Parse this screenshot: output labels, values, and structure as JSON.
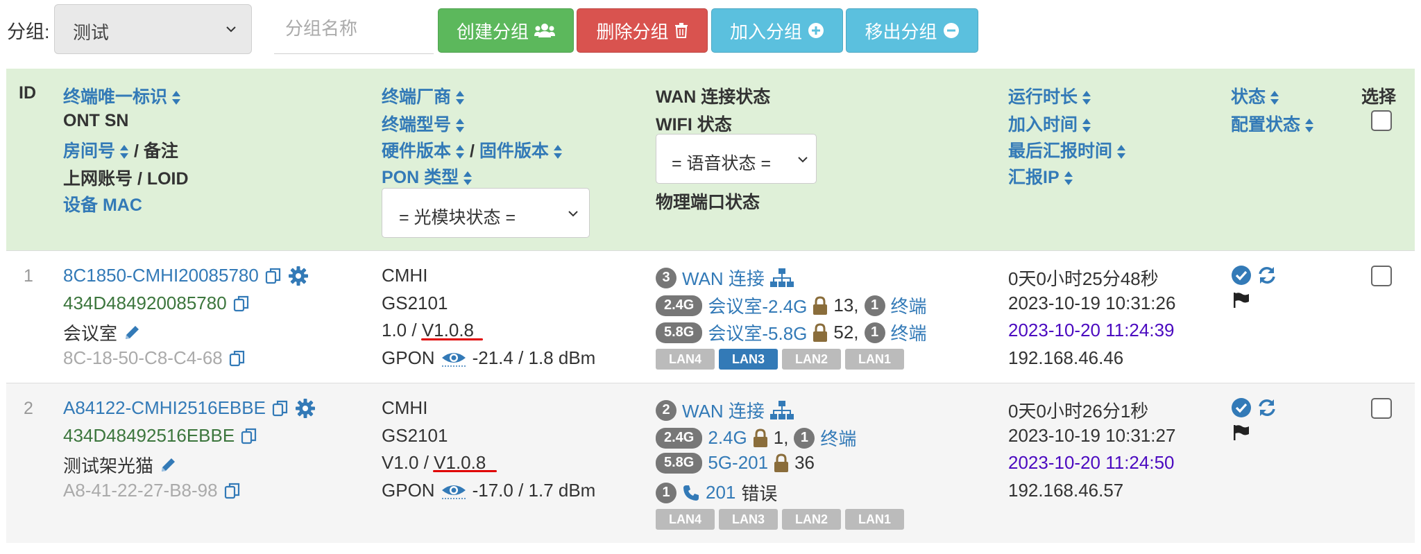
{
  "toolbar": {
    "group_label": "分组:",
    "group_select_value": "测试",
    "group_name_placeholder": "分组名称",
    "create_label": "创建分组",
    "delete_label": "删除分组",
    "join_label": "加入分组",
    "leave_label": "移出分组"
  },
  "header": {
    "id": "ID",
    "terminal_id": "终端唯一标识",
    "ont_sn": "ONT SN",
    "room": "房间号",
    "slash_remark": "/ 备注",
    "account": "上网账号 / LOID",
    "mac": "设备 MAC",
    "vendor": "终端厂商",
    "model": "终端型号",
    "hw_version": "硬件版本",
    "slash": "/",
    "fw_version": "固件版本",
    "pon_type": "PON 类型",
    "optical_select": "= 光模块状态 =",
    "wan_status": "WAN 连接状态",
    "wifi_status": "WIFI 状态",
    "voice_select": "= 语音状态 =",
    "port_status": "物理端口状态",
    "uptime": "运行时长",
    "join_time": "加入时间",
    "last_report": "最后汇报时间",
    "report_ip": "汇报IP",
    "state": "状态",
    "config_state": "配置状态",
    "select": "选择"
  },
  "rows": [
    {
      "id": "1",
      "terminal_id": "8C1850-CMHI20085780",
      "ont_sn": "434D484920085780",
      "remark": "会议室",
      "mac": "8C-18-50-C8-C4-68",
      "vendor": "CMHI",
      "model": "GS2101",
      "hw_version": "1.0 / ",
      "fw_version": "V1.0.8",
      "pon": "GPON",
      "optical": "-21.4 / 1.8 dBm",
      "wan_count": "3",
      "wan_label": "WAN 连接",
      "wifi24_badge": "2.4G",
      "wifi24_name": "会议室-2.4G",
      "wifi24_channel": "13,",
      "wifi24_clients": "1",
      "wifi24_clients_label": "终端",
      "wifi58_badge": "5.8G",
      "wifi58_name": "会议室-5.8G",
      "wifi58_channel": "52,",
      "wifi58_clients": "1",
      "wifi58_clients_label": "终端",
      "lan": [
        "LAN4",
        "LAN3",
        "LAN2",
        "LAN1"
      ],
      "lan_active": "LAN3",
      "uptime": "0天0小时25分48秒",
      "join_time": "2023-10-19 10:31:26",
      "last_report": "2023-10-20 11:24:39",
      "report_ip": "192.168.46.46"
    },
    {
      "id": "2",
      "terminal_id": "A84122-CMHI2516EBBE",
      "ont_sn": "434D48492516EBBE",
      "remark": "测试架光猫",
      "mac": "A8-41-22-27-B8-98",
      "vendor": "CMHI",
      "model": "GS2101",
      "hw_version": "V1.0 / ",
      "fw_version": "V1.0.8",
      "pon": "GPON",
      "optical": "-17.0 / 1.7 dBm",
      "wan_count": "2",
      "wan_label": "WAN 连接",
      "wifi24_badge": "2.4G",
      "wifi24_name": "2.4G",
      "wifi24_channel": "1,",
      "wifi24_clients": "1",
      "wifi24_clients_label": "终端",
      "wifi58_badge": "5.8G",
      "wifi58_name": "5G-201",
      "wifi58_channel": "36",
      "voice_count": "1",
      "voice_number": "201",
      "voice_status": "错误",
      "lan": [
        "LAN4",
        "LAN3",
        "LAN2",
        "LAN1"
      ],
      "uptime": "0天0小时26分1秒",
      "join_time": "2023-10-19 10:31:27",
      "last_report": "2023-10-20 11:24:50",
      "report_ip": "192.168.46.57"
    }
  ],
  "colors": {
    "link": "#337ab7",
    "sn_green": "#3c763d",
    "last_report_purple": "#4b0ac0",
    "header_bg": "#dff0d8",
    "create_green": "#5cb85c",
    "delete_red": "#d9534f",
    "join_blue": "#5bc0de",
    "annotation_red": "#e00000"
  }
}
